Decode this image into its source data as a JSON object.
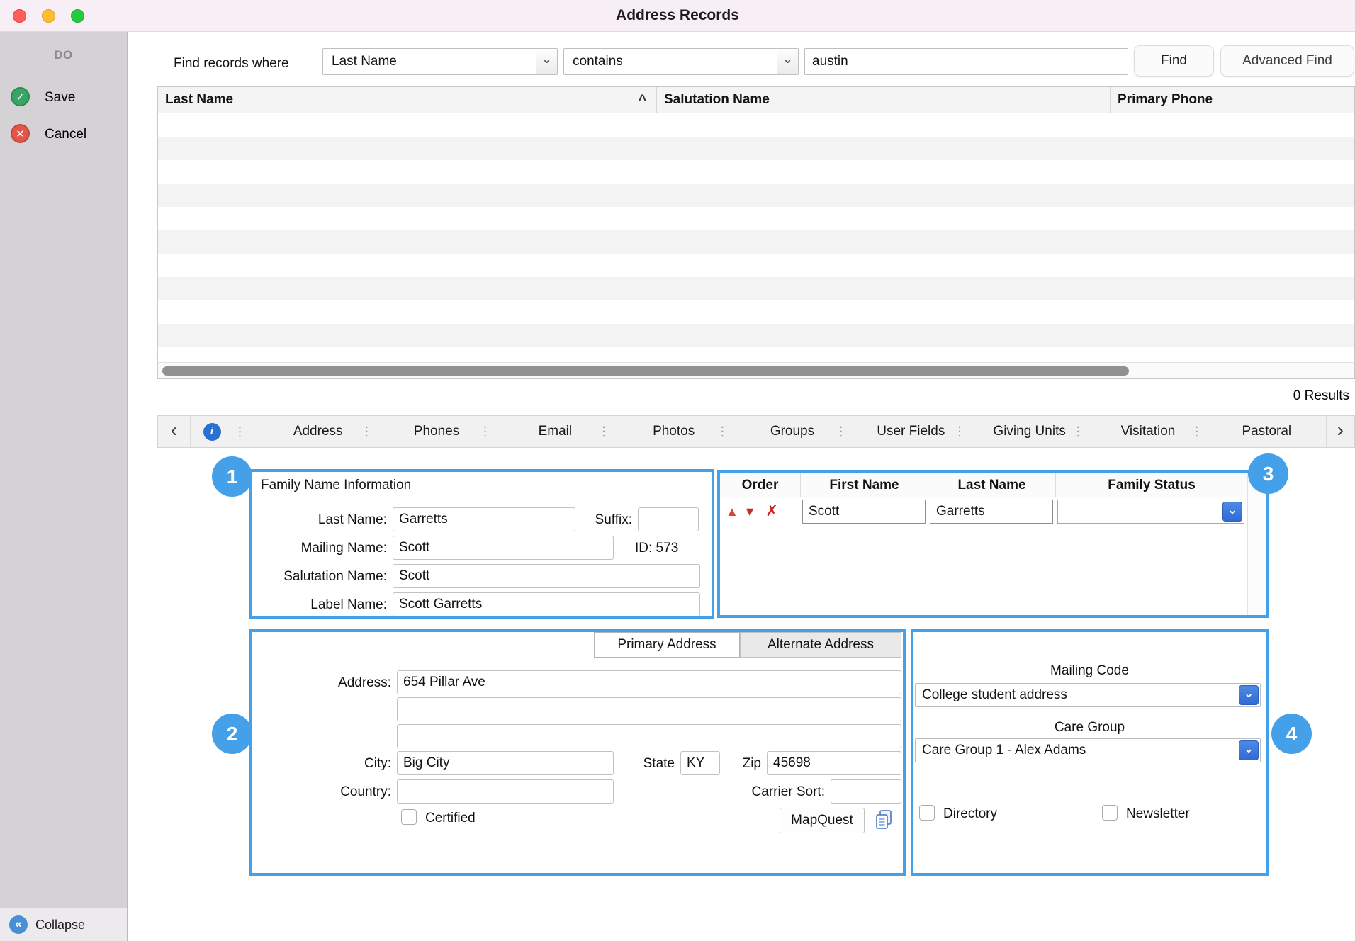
{
  "window": {
    "title": "Address Records",
    "results_text": "0 Results"
  },
  "sidebar": {
    "header": "DO",
    "save_label": "Save",
    "cancel_label": "Cancel",
    "collapse_label": "Collapse"
  },
  "search": {
    "label": "Find records where",
    "field_selected": "Last Name",
    "operator_selected": "contains",
    "query_value": "austin",
    "find_button": "Find",
    "advanced_find_button": "Advanced Find"
  },
  "results_table": {
    "columns": [
      "Last Name",
      "Salutation Name",
      "Primary Phone"
    ]
  },
  "tabs": {
    "items": [
      "Address",
      "Phones",
      "Email",
      "Photos",
      "Groups",
      "User Fields",
      "Giving Units",
      "Visitation",
      "Pastoral"
    ]
  },
  "badges": {
    "b1": "1",
    "b2": "2",
    "b3": "3",
    "b4": "4"
  },
  "family_panel": {
    "title": "Family Name Information",
    "last_name_label": "Last Name:",
    "last_name_value": "Garretts",
    "suffix_label": "Suffix:",
    "suffix_value": "",
    "mailing_name_label": "Mailing Name:",
    "mailing_name_value": "Scott",
    "id_text": "ID: 573",
    "salutation_label": "Salutation Name:",
    "salutation_value": "Scott",
    "label_name_label": "Label Name:",
    "label_name_value": "Scott Garretts"
  },
  "members_panel": {
    "columns": [
      "Order",
      "First Name",
      "Last Name",
      "Family Status"
    ],
    "row": {
      "first_name": "Scott",
      "last_name": "Garretts",
      "family_status": ""
    }
  },
  "address_panel": {
    "primary_tab": "Primary Address",
    "alternate_tab": "Alternate Address",
    "address_label": "Address:",
    "address_line1": "654 Pillar Ave",
    "address_line2": "",
    "address_line3": "",
    "city_label": "City:",
    "city_value": "Big City",
    "state_label": "State",
    "state_value": "KY",
    "zip_label": "Zip",
    "zip_value": "45698",
    "country_label": "Country:",
    "country_value": "",
    "carrier_sort_label": "Carrier Sort:",
    "carrier_sort_value": "",
    "certified_label": "Certified",
    "mapquest_button": "MapQuest"
  },
  "codes_panel": {
    "mailing_code_label": "Mailing Code",
    "mailing_code_value": "College student address",
    "care_group_label": "Care Group",
    "care_group_value": "Care Group 1 - Alex Adams",
    "directory_label": "Directory",
    "newsletter_label": "Newsletter"
  },
  "icons": {
    "sort_asc": "^",
    "chevron_down": "⌄",
    "chevron_left": "‹",
    "chevron_right": "›",
    "collapse": "«",
    "check": "✓",
    "cross": "✕",
    "info": "i",
    "drag_dots": "⋮",
    "move_up": "▲",
    "move_down": "▼",
    "delete": "✗"
  }
}
